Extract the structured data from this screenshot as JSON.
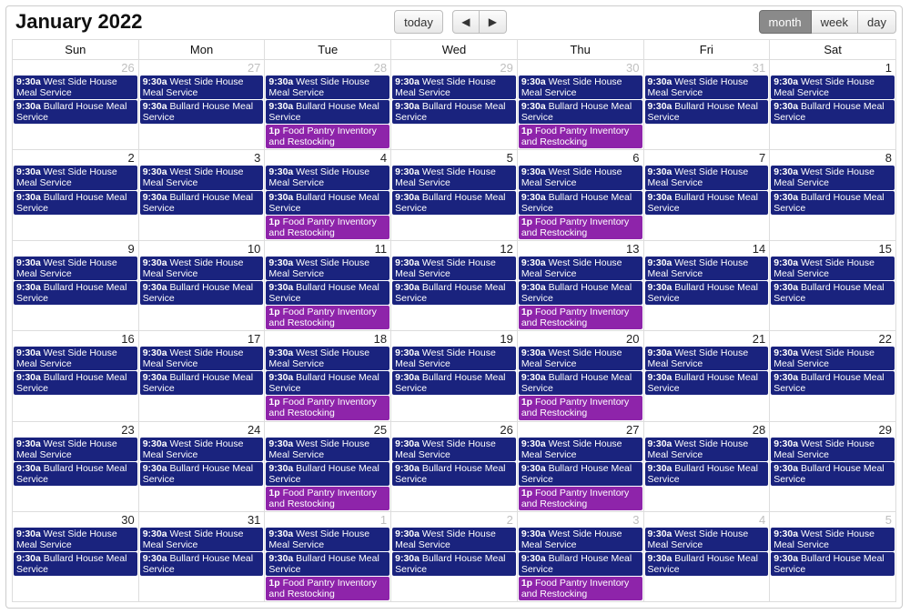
{
  "header": {
    "title": "January 2022"
  },
  "toolbar": {
    "today": "today",
    "views": {
      "month": "month",
      "week": "week",
      "day": "day"
    },
    "active_view": "month"
  },
  "day_headers": [
    "Sun",
    "Mon",
    "Tue",
    "Wed",
    "Thu",
    "Fri",
    "Sat"
  ],
  "event_templates": {
    "west": {
      "time": "9:30a",
      "title": "West Side House Meal Service",
      "color": "blue"
    },
    "bullard": {
      "time": "9:30a",
      "title": "Bullard House Meal Service",
      "color": "blue"
    },
    "pantry": {
      "time": "1p",
      "title": "Food Pantry Inventory and Restocking",
      "color": "purple"
    }
  },
  "base_events": [
    "west",
    "bullard"
  ],
  "tue_thu_extra": "pantry",
  "weeks": [
    [
      {
        "n": 26,
        "o": true,
        "dow": 0
      },
      {
        "n": 27,
        "o": true,
        "dow": 1
      },
      {
        "n": 28,
        "o": true,
        "dow": 2
      },
      {
        "n": 29,
        "o": true,
        "dow": 3
      },
      {
        "n": 30,
        "o": true,
        "dow": 4
      },
      {
        "n": 31,
        "o": true,
        "dow": 5
      },
      {
        "n": 1,
        "o": false,
        "dow": 6
      }
    ],
    [
      {
        "n": 2,
        "o": false,
        "dow": 0
      },
      {
        "n": 3,
        "o": false,
        "dow": 1
      },
      {
        "n": 4,
        "o": false,
        "dow": 2
      },
      {
        "n": 5,
        "o": false,
        "dow": 3
      },
      {
        "n": 6,
        "o": false,
        "dow": 4
      },
      {
        "n": 7,
        "o": false,
        "dow": 5
      },
      {
        "n": 8,
        "o": false,
        "dow": 6
      }
    ],
    [
      {
        "n": 9,
        "o": false,
        "dow": 0
      },
      {
        "n": 10,
        "o": false,
        "dow": 1
      },
      {
        "n": 11,
        "o": false,
        "dow": 2
      },
      {
        "n": 12,
        "o": false,
        "dow": 3
      },
      {
        "n": 13,
        "o": false,
        "dow": 4
      },
      {
        "n": 14,
        "o": false,
        "dow": 5
      },
      {
        "n": 15,
        "o": false,
        "dow": 6
      }
    ],
    [
      {
        "n": 16,
        "o": false,
        "dow": 0
      },
      {
        "n": 17,
        "o": false,
        "dow": 1
      },
      {
        "n": 18,
        "o": false,
        "dow": 2
      },
      {
        "n": 19,
        "o": false,
        "dow": 3
      },
      {
        "n": 20,
        "o": false,
        "dow": 4
      },
      {
        "n": 21,
        "o": false,
        "dow": 5
      },
      {
        "n": 22,
        "o": false,
        "dow": 6
      }
    ],
    [
      {
        "n": 23,
        "o": false,
        "dow": 0
      },
      {
        "n": 24,
        "o": false,
        "dow": 1
      },
      {
        "n": 25,
        "o": false,
        "dow": 2
      },
      {
        "n": 26,
        "o": false,
        "dow": 3
      },
      {
        "n": 27,
        "o": false,
        "dow": 4
      },
      {
        "n": 28,
        "o": false,
        "dow": 5
      },
      {
        "n": 29,
        "o": false,
        "dow": 6
      }
    ],
    [
      {
        "n": 30,
        "o": false,
        "dow": 0
      },
      {
        "n": 31,
        "o": false,
        "dow": 1
      },
      {
        "n": 1,
        "o": true,
        "dow": 2
      },
      {
        "n": 2,
        "o": true,
        "dow": 3
      },
      {
        "n": 3,
        "o": true,
        "dow": 4
      },
      {
        "n": 4,
        "o": true,
        "dow": 5
      },
      {
        "n": 5,
        "o": true,
        "dow": 6
      }
    ]
  ]
}
